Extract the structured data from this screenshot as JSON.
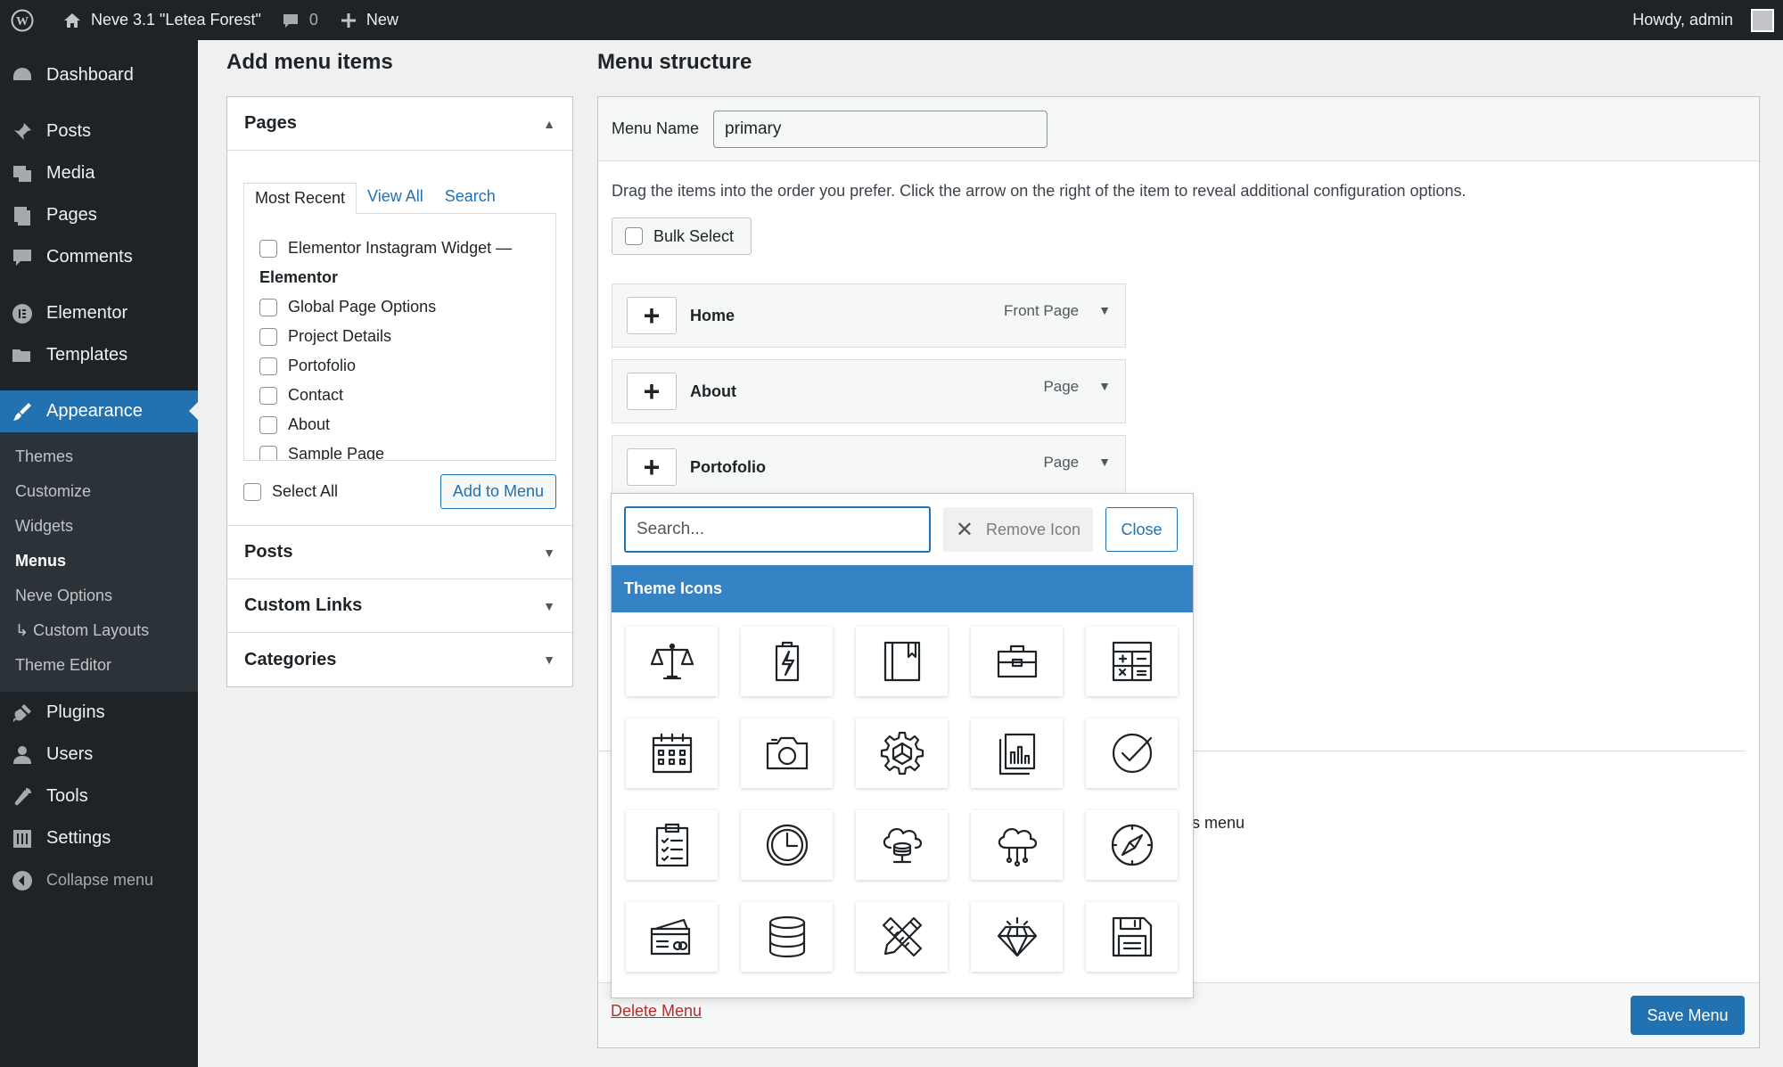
{
  "adminbar": {
    "site_name": "Neve 3.1 \"Letea Forest\"",
    "comments_count": "0",
    "new_label": "New",
    "greeting": "Howdy, admin"
  },
  "sidebar": {
    "items": [
      {
        "label": "Dashboard",
        "icon": "dashboard-icon"
      },
      {
        "label": "Posts",
        "icon": "pin-icon"
      },
      {
        "label": "Media",
        "icon": "media-icon"
      },
      {
        "label": "Pages",
        "icon": "pages-icon"
      },
      {
        "label": "Comments",
        "icon": "comment-icon"
      },
      {
        "label": "Elementor",
        "icon": "elementor-icon"
      },
      {
        "label": "Templates",
        "icon": "folder-icon"
      },
      {
        "label": "Appearance",
        "icon": "brush-icon"
      }
    ],
    "submenu": [
      "Themes",
      "Customize",
      "Widgets",
      "Menus",
      "Neve Options",
      "↳ Custom Layouts",
      "Theme Editor"
    ],
    "items_bottom": [
      {
        "label": "Plugins",
        "icon": "plug-icon"
      },
      {
        "label": "Users",
        "icon": "user-icon"
      },
      {
        "label": "Tools",
        "icon": "wrench-icon"
      },
      {
        "label": "Settings",
        "icon": "settings-icon"
      }
    ],
    "collapse_label": "Collapse menu"
  },
  "add_menu_items": {
    "heading": "Add menu items",
    "pages_title": "Pages",
    "tabs": [
      "Most Recent",
      "View All",
      "Search"
    ],
    "page_list": [
      "Elementor Instagram Widget —",
      "Elementor",
      "Global Page Options",
      "Project Details",
      "Portofolio",
      "Contact",
      "About",
      "Sample Page"
    ],
    "select_all": "Select All",
    "add_button": "Add to Menu",
    "sections": [
      "Posts",
      "Custom Links",
      "Categories"
    ]
  },
  "menu_structure": {
    "heading": "Menu structure",
    "menu_name_label": "Menu Name",
    "menu_name_value": "primary",
    "instructions": "Drag the items into the order you prefer. Click the arrow on the right of the item to reveal additional configuration options.",
    "bulk_select": "Bulk Select",
    "items": [
      {
        "title": "Home",
        "type": "Front Page"
      },
      {
        "title": "About",
        "type": "Page"
      },
      {
        "title": "Portofolio",
        "type": "Page"
      }
    ],
    "partial_text": "is menu",
    "delete_link": "Delete Menu",
    "save_button": "Save Menu"
  },
  "icon_picker": {
    "search_placeholder": "Search...",
    "remove_label": "Remove Icon",
    "close_label": "Close",
    "section_title": "Theme Icons",
    "icons": [
      "scales-icon",
      "battery-icon",
      "book-icon",
      "briefcase-icon",
      "calculator-icon",
      "calendar-icon",
      "camera-icon",
      "gear-icon",
      "report-icon",
      "check-circle-icon",
      "clipboard-icon",
      "clock-icon",
      "cloud-database-icon",
      "cloud-network-icon",
      "compass-icon",
      "credit-card-icon",
      "database-icon",
      "pencil-ruler-icon",
      "diamond-icon",
      "save-disk-icon"
    ]
  },
  "colors": {
    "accent": "#2271b1",
    "sidebar_bg": "#1d2327",
    "picker_header": "#3582c4",
    "danger": "#b32d2e"
  }
}
